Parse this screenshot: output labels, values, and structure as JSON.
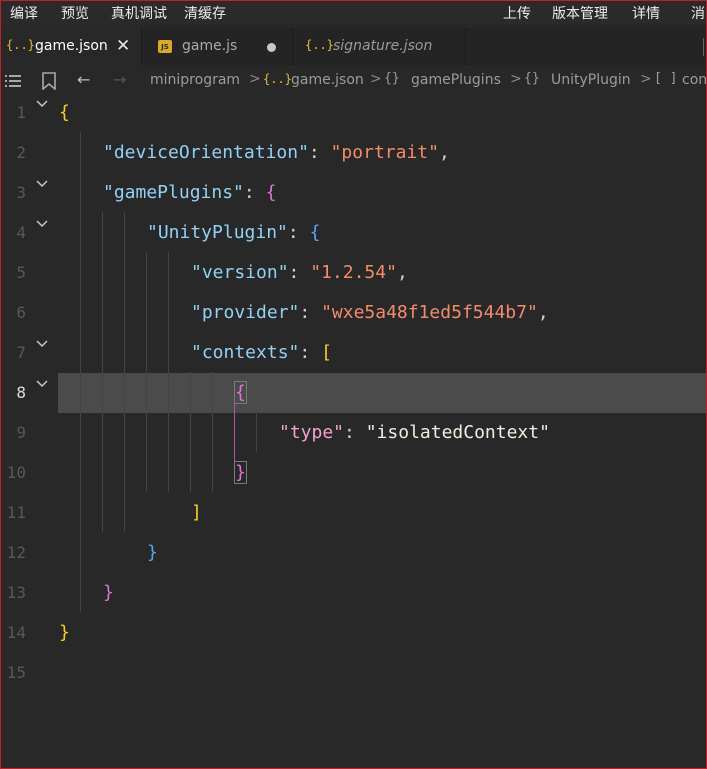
{
  "menubar": {
    "compile": "编译",
    "preview": "预览",
    "remote_debug": "真机调试",
    "clear_cache": "清缓存",
    "upload": "上传",
    "version_mgmt": "版本管理",
    "details": "详情",
    "msg": "消"
  },
  "tabs": [
    {
      "icon": "{..}",
      "label": "game.json",
      "close": "✕"
    },
    {
      "icon": "JS",
      "label": "game.js"
    },
    {
      "icon": "{..}",
      "label": "signature.json"
    }
  ],
  "breadcrumb": {
    "back": "←",
    "forward": "→",
    "items": [
      "miniprogram",
      "game.json",
      "gamePlugins",
      "UnityPlugin",
      "con"
    ],
    "obj_icon": "{}",
    "arr_icon": "[ ]",
    "file_icon": "{..}",
    "sep": ">"
  },
  "editor": {
    "line_numbers": [
      "1",
      "2",
      "3",
      "4",
      "5",
      "6",
      "7",
      "8",
      "9",
      "10",
      "11",
      "12",
      "13",
      "14",
      "15"
    ],
    "current_line": "8",
    "lines": {
      "l1": {
        "brace": "{"
      },
      "l2": {
        "key": "\"deviceOrientation\"",
        "colon": ": ",
        "value": "\"portrait\"",
        "comma": ","
      },
      "l3": {
        "key": "\"gamePlugins\"",
        "colon": ": ",
        "brace": "{"
      },
      "l4": {
        "key": "\"UnityPlugin\"",
        "colon": ": ",
        "brace": "{"
      },
      "l5": {
        "key": "\"version\"",
        "colon": ": ",
        "value": "\"1.2.54\"",
        "comma": ","
      },
      "l6": {
        "key": "\"provider\"",
        "colon": ": ",
        "value": "\"wxe5a48f1ed5f544b7\"",
        "comma": ","
      },
      "l7": {
        "key": "\"contexts\"",
        "colon": ": ",
        "bracket": "["
      },
      "l8": {
        "brace": "{"
      },
      "l9": {
        "key": "\"type\"",
        "colon": ": ",
        "value": "\"isolatedContext\""
      },
      "l10": {
        "brace": "}"
      },
      "l11": {
        "bracket": "]"
      },
      "l12": {
        "brace": "}"
      },
      "l13": {
        "brace": "}"
      },
      "l14": {
        "brace": "}"
      }
    }
  },
  "colors": {
    "background": "#282828",
    "key": "#92d1f6",
    "string": "#f38c6c",
    "bracket_gold": "#f6cf25",
    "bracket_purple": "#de74d6",
    "bracket_blue": "#55a6f5"
  }
}
